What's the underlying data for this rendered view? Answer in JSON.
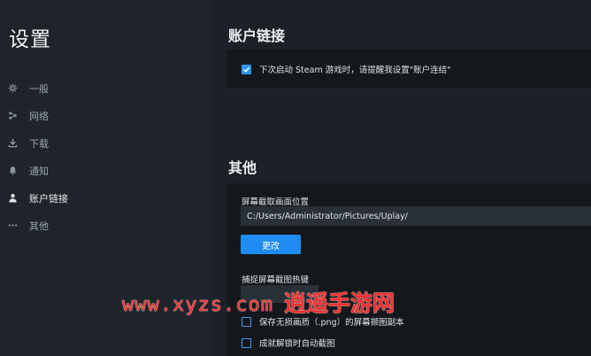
{
  "app": {
    "title": "设置"
  },
  "sidebar": {
    "items": [
      {
        "label": "一般",
        "icon": "gear-icon"
      },
      {
        "label": "网络",
        "icon": "network-icon"
      },
      {
        "label": "下载",
        "icon": "download-icon"
      },
      {
        "label": "通知",
        "icon": "bell-icon"
      },
      {
        "label": "账户链接",
        "icon": "user-icon",
        "active": true
      },
      {
        "label": "其他",
        "icon": "more-icon"
      }
    ]
  },
  "account_link": {
    "title": "账户链接",
    "steam_reminder": {
      "label": "下次启动 Steam 游戏时，请提醒我设置\"账户连结\"",
      "checked": true
    }
  },
  "other": {
    "title": "其他",
    "screenshot_location": {
      "label": "屏幕截取画面位置",
      "value": "C:/Users/Administrator/Pictures/Uplay/",
      "button_label": "更改"
    },
    "hotkey": {
      "label": "捕捉屏幕截图热键"
    },
    "save_lossless": {
      "label": "保存无损画质（.png）的屏幕撷图副本",
      "checked": false
    },
    "auto_screenshot_achievement": {
      "label": "成就解锁时自动截图",
      "checked": false
    }
  },
  "watermark": {
    "url": "www.xyzs.com",
    "name": "逍遥手游网"
  },
  "colors": {
    "accent": "#1e8cf0",
    "background": "#1c2127",
    "panel": "#14181c"
  }
}
